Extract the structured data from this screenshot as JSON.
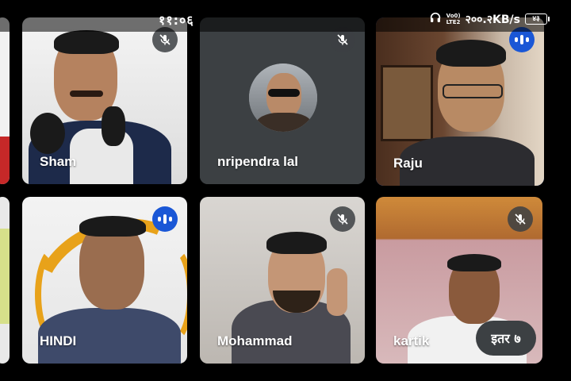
{
  "status": {
    "time": "११:०६",
    "network_top": "Vo0)",
    "network_bottom": "LTE2",
    "speed": "२००.२KB/s",
    "battery": "४३"
  },
  "participants": [
    {
      "name": "Sham",
      "muted": true
    },
    {
      "name": "nripendra lal",
      "muted": true
    },
    {
      "name": "Raju",
      "muted": false,
      "speaking": true
    },
    {
      "name": "HINDI",
      "muted": false,
      "speaking": true
    },
    {
      "name": "Mohammad",
      "muted": true
    },
    {
      "name": "kartik",
      "muted": true
    }
  ],
  "others_button": "इतर ७",
  "colors": {
    "active_outline": "#3b6fe0",
    "speaking_badge": "#1a57d6",
    "tile_bg": "#3c4043"
  }
}
